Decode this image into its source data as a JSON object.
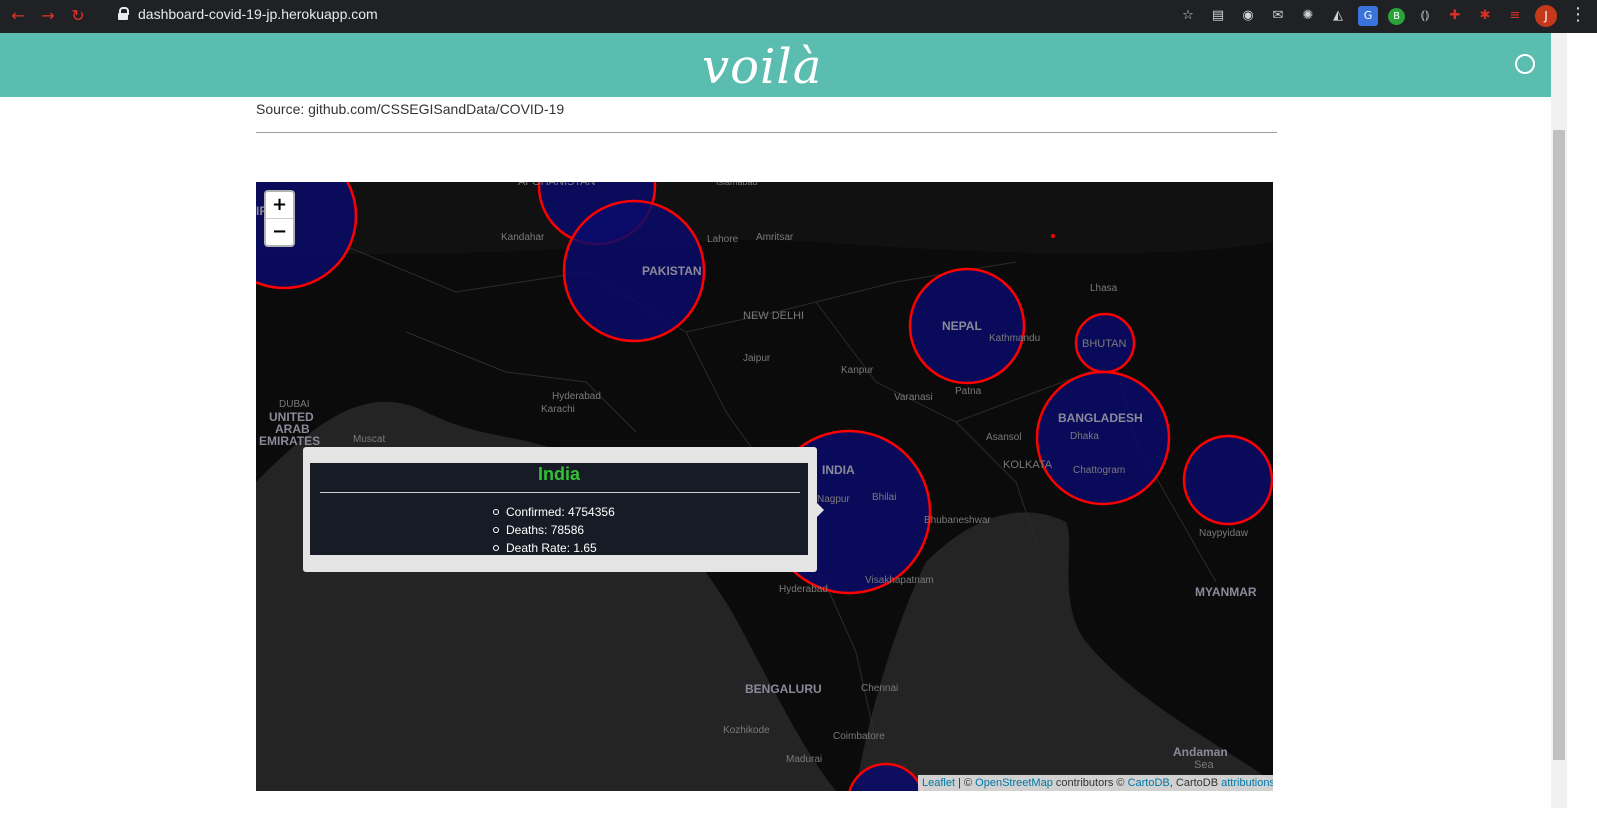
{
  "browser": {
    "url": "dashboard-covid-19-jp.herokuapp.com",
    "profile_initial": "J",
    "ext_b": "B",
    "ext_g": "G"
  },
  "header": {
    "logo_text": "voilà"
  },
  "page": {
    "source_text": "Source: github.com/CSSEGISandData/COVID-19"
  },
  "map": {
    "zoom_in": "+",
    "zoom_out": "−",
    "labels": [
      {
        "text": "AFGHANISTAN"
      },
      {
        "text": "Islamabad"
      },
      {
        "text": "Kandahar"
      },
      {
        "text": "Lahore"
      },
      {
        "text": "Amritsar"
      },
      {
        "text": "PAKISTAN"
      },
      {
        "text": "IRAN"
      },
      {
        "text": "NEW DELHI"
      },
      {
        "text": "Jaipur"
      },
      {
        "text": "NEPAL"
      },
      {
        "text": "Kathmandu"
      },
      {
        "text": "BHUTAN"
      },
      {
        "text": "Lhasa"
      },
      {
        "text": "Kanpur"
      },
      {
        "text": "Varanasi"
      },
      {
        "text": "Patna"
      },
      {
        "text": "Hyderabad"
      },
      {
        "text": "Karachi"
      },
      {
        "text": "DUBAI"
      },
      {
        "text": "UNITED"
      },
      {
        "text": "ARAB"
      },
      {
        "text": "EMIRATES"
      },
      {
        "text": "Muscat"
      },
      {
        "text": "Asansol"
      },
      {
        "text": "BANGLADESH"
      },
      {
        "text": "Dhaka"
      },
      {
        "text": "KOLKATA"
      },
      {
        "text": "Chattogram"
      },
      {
        "text": "INDIA"
      },
      {
        "text": "Nagpur"
      },
      {
        "text": "Bhilai"
      },
      {
        "text": "Bhubaneshwar"
      },
      {
        "text": "Naypyidaw"
      },
      {
        "text": "Visakhapatnam"
      },
      {
        "text": "Hyderabad"
      },
      {
        "text": "MYANMAR"
      },
      {
        "text": "BENGALURU"
      },
      {
        "text": "Chennai"
      },
      {
        "text": "Kozhikode"
      },
      {
        "text": "Coimbatore"
      },
      {
        "text": "Madurai"
      },
      {
        "text": "Andaman"
      },
      {
        "text": "Sea"
      }
    ],
    "popup": {
      "title": "India",
      "confirmed": "Confirmed: 4754356",
      "deaths": "Deaths: 78586",
      "death_rate": "Death Rate: 1.65"
    },
    "attribution": {
      "leaflet": "Leaflet",
      "sep": " | © ",
      "osm": "OpenStreetMap",
      "contrib": " contributors © ",
      "cartodb": "CartoDB",
      "cartodb2": ", CartoDB ",
      "attributions": "attributions"
    }
  },
  "colors": {
    "header_bg": "#5bbcb0",
    "circle_stroke": "#ff0000",
    "circle_fill": "#0a0a6a",
    "popup_title": "#32c132"
  }
}
